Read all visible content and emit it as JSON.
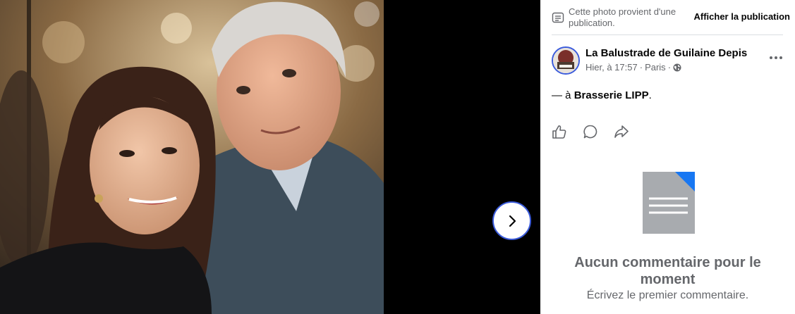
{
  "viewer": {
    "photo_alt": "Photo",
    "next_icon": "chevron-right-icon"
  },
  "panel": {
    "origin_text": "Cette photo provient d'une publication.",
    "origin_link": "Afficher la publication",
    "author": "La Balustrade de Guilaine Depis",
    "time": "Hier, à 17:57",
    "separator": "·",
    "location": "Paris",
    "privacy_icon": "globe-icon",
    "post_prefix": "— à",
    "post_place": "Brasserie LIPP",
    "post_suffix": ".",
    "empty_title": "Aucun commentaire pour le moment",
    "empty_subtitle": "Écrivez le premier commentaire."
  },
  "colors": {
    "accent": "#3b5bdb",
    "doc_blue": "#1877f2",
    "doc_gray": "#a8abaf"
  }
}
